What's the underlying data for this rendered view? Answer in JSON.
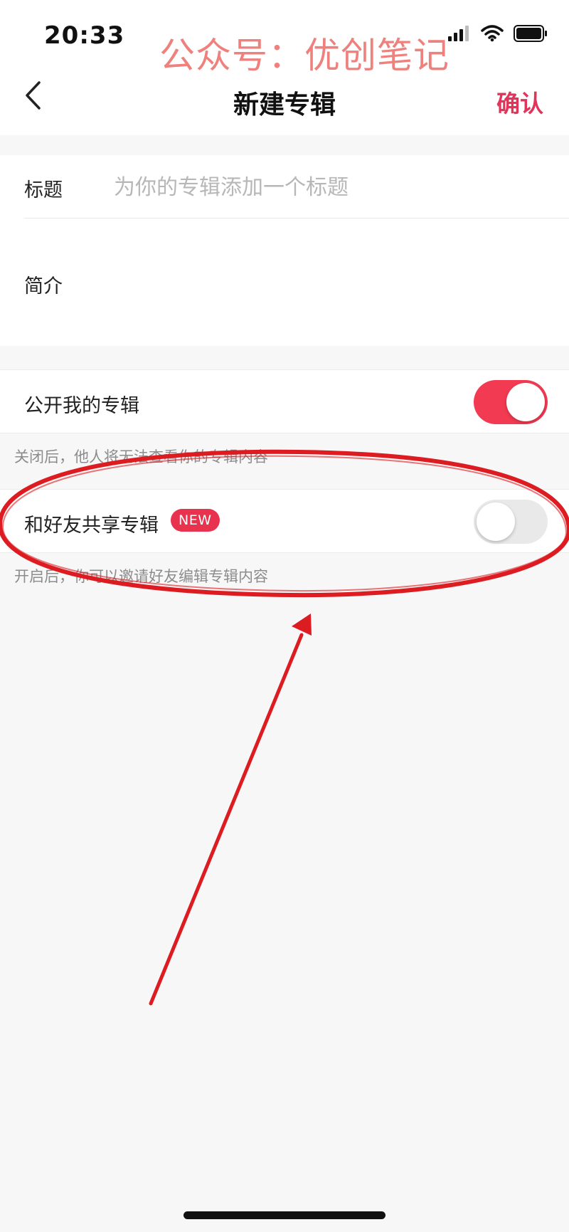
{
  "status_bar": {
    "time": "20:33",
    "watermark": "公众号：优创笔记",
    "icons": [
      "signal-icon",
      "wifi-icon",
      "battery-icon"
    ]
  },
  "nav": {
    "back_icon": "chevron-left-icon",
    "title": "新建专辑",
    "confirm_label": "确认"
  },
  "form": {
    "title_label": "标题",
    "title_placeholder": "为你的专辑添加一个标题",
    "title_value": "",
    "intro_label": "简介",
    "intro_value": ""
  },
  "public_toggle": {
    "label": "公开我的专辑",
    "on": true,
    "hint": "关闭后，他人将无法查看你的专辑内容"
  },
  "share_toggle": {
    "label": "和好友共享专辑",
    "badge": "NEW",
    "on": false,
    "hint": "开启后，你可以邀请好友编辑专辑内容"
  },
  "colors": {
    "accent": "#e0345b",
    "toggle_on": "#f23a52",
    "annotation": "#dd1c22",
    "watermark": "#ee7b77"
  }
}
